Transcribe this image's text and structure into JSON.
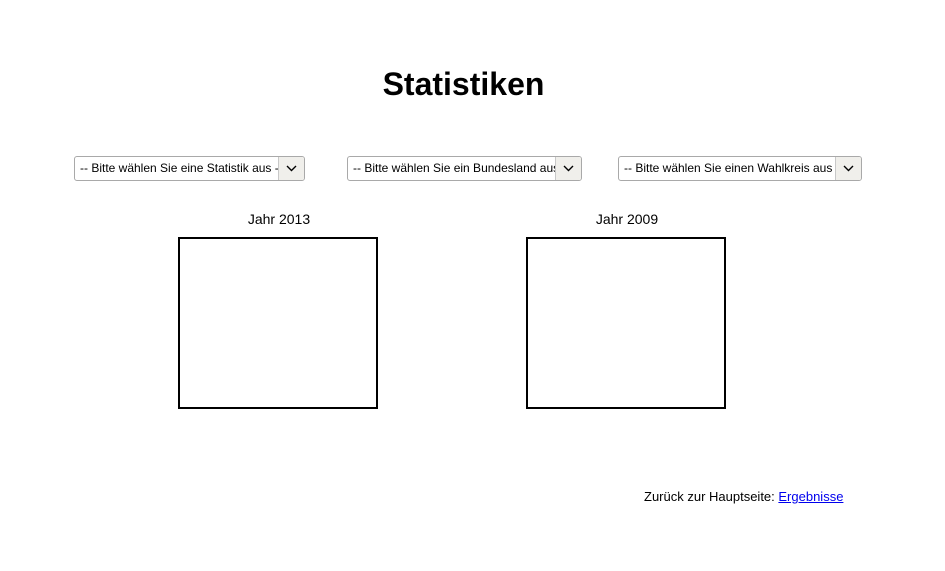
{
  "title": "Statistiken",
  "selects": {
    "statistik": {
      "selected": "-- Bitte wählen Sie eine Statistik aus --"
    },
    "bundesland": {
      "selected": "-- Bitte wählen Sie ein Bundesland aus --"
    },
    "wahlkreis": {
      "selected": "-- Bitte wählen Sie einen Wahlkreis aus --"
    }
  },
  "charts": [
    {
      "label": "Jahr 2013"
    },
    {
      "label": "Jahr 2009"
    }
  ],
  "footer": {
    "text": "Zurück zur Hauptseite: ",
    "link_label": "Ergebnisse"
  },
  "icons": {
    "select_arrow": "chevron-down-icon"
  }
}
